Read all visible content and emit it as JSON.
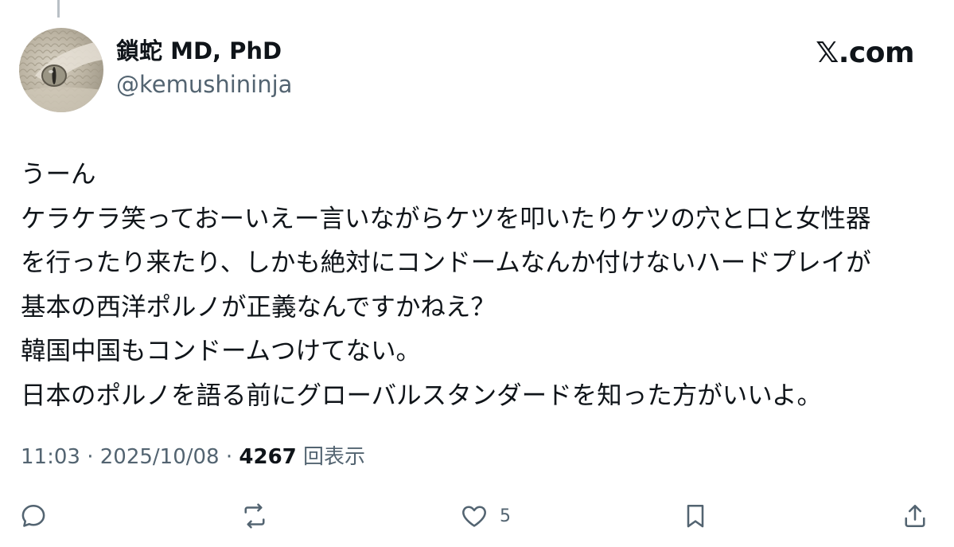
{
  "author": {
    "name": "鎖蛇 MD, PhD",
    "handle": "@kemushininja"
  },
  "brand": "𝕏.com",
  "tweet": {
    "lines": [
      "うーん",
      "ケラケラ笑っておーいえー言いながらケツを叩いたりケツの穴と口と女性器",
      "を行ったり来たり、しかも絶対にコンドームなんか付けないハードプレイが",
      "基本の西洋ポルノが正義なんですかねえ？",
      "韓国中国もコンドームつけてない。",
      "日本のポルノを語る前にグローバルスタンダードを知った方がいいよ。"
    ]
  },
  "meta": {
    "time": "11:03",
    "date": "2025/10/08",
    "views_count": "4267",
    "views_label": "回表示"
  },
  "actions": {
    "like_count": "5"
  },
  "icons": {
    "reply": "reply-icon",
    "repost": "repost-icon",
    "like": "heart-icon",
    "bookmark": "bookmark-icon",
    "share": "share-icon"
  }
}
